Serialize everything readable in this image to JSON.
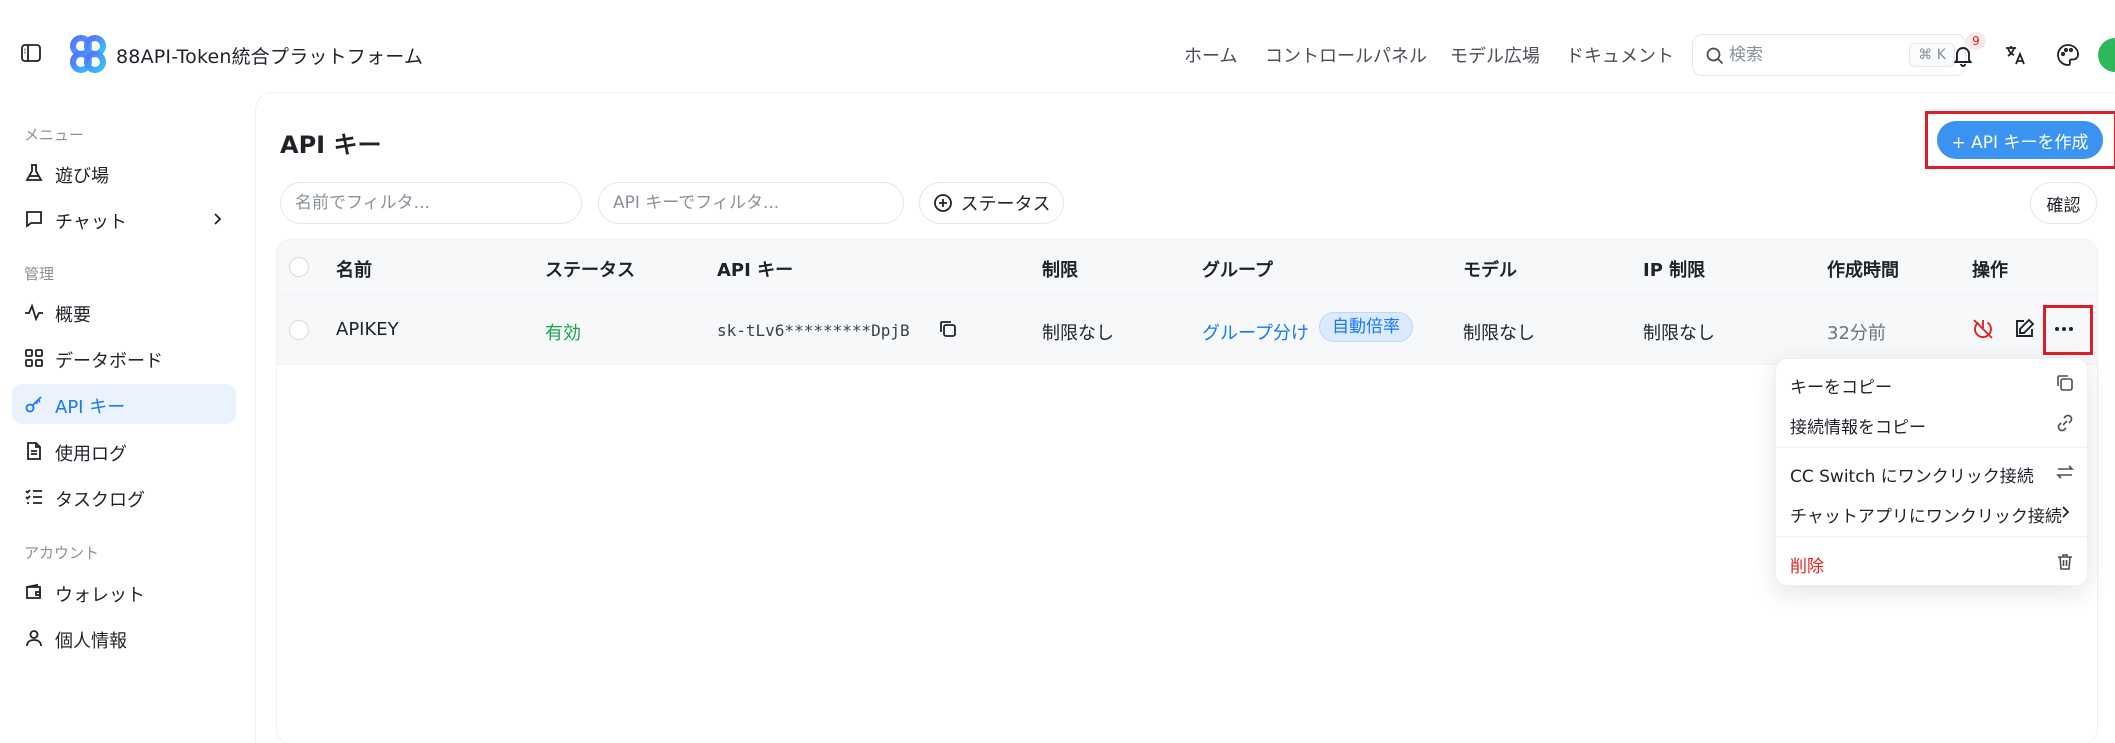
{
  "header": {
    "app_title": "88API-Token統合プラットフォーム",
    "nav": [
      "ホーム",
      "コントロールパネル",
      "モデル広場",
      "ドキュメント"
    ],
    "search_placeholder": "検索",
    "search_shortcut": "⌘ K",
    "notification_count": "9",
    "icons": [
      "sidebar-toggle-icon",
      "bell-icon",
      "translate-icon",
      "palette-icon"
    ]
  },
  "sidebar": {
    "sections": [
      {
        "label": "メニュー",
        "items": [
          {
            "label": "遊び場",
            "icon": "flask-icon"
          },
          {
            "label": "チャット",
            "icon": "chat-icon",
            "has_submenu": true
          }
        ]
      },
      {
        "label": "管理",
        "items": [
          {
            "label": "概要",
            "icon": "activity-icon"
          },
          {
            "label": "データボード",
            "icon": "grid-icon"
          },
          {
            "label": "API キー",
            "icon": "key-icon",
            "active": true
          },
          {
            "label": "使用ログ",
            "icon": "document-icon"
          },
          {
            "label": "タスクログ",
            "icon": "tasks-icon"
          }
        ]
      },
      {
        "label": "アカウント",
        "items": [
          {
            "label": "ウォレット",
            "icon": "wallet-icon"
          },
          {
            "label": "個人情報",
            "icon": "user-icon"
          }
        ]
      }
    ]
  },
  "main": {
    "title": "API キー",
    "create_button": "+ API キーを作成",
    "filter_name_placeholder": "名前でフィルタ...",
    "filter_key_placeholder": "API キーでフィルタ...",
    "status_button": "ステータス",
    "confirm_button": "確認",
    "table": {
      "columns": [
        "名前",
        "ステータス",
        "API キー",
        "制限",
        "グループ",
        "モデル",
        "IP 制限",
        "作成時間",
        "操作"
      ],
      "rows": [
        {
          "name": "APIKEY",
          "status": "有効",
          "api_key": "sk-tLv6*********DpjB",
          "limit": "制限なし",
          "group": "グループ分け",
          "group_tag": "自動倍率",
          "model": "制限なし",
          "ip_limit": "制限なし",
          "created": "32分前"
        }
      ]
    },
    "menu": {
      "items": [
        "キーをコピー",
        "接続情報をコピー",
        "CC Switch にワンクリック接続",
        "チャットアプリにワンクリック接続",
        "削除"
      ]
    }
  },
  "colors": {
    "accent": "#3b94f2",
    "active_bg": "#e9f2fd",
    "success": "#16a34a",
    "danger": "#e02424",
    "highlight": "#e11d2a"
  }
}
